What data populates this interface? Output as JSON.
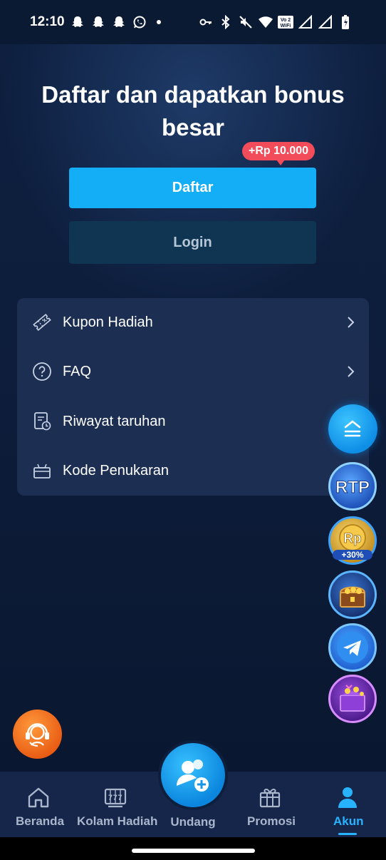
{
  "status_bar": {
    "time": "12:10",
    "left_icons": [
      "snapchat-icon",
      "snapchat-icon",
      "snapchat-icon",
      "whatsapp-icon"
    ],
    "right_icons": [
      "key-icon",
      "bluetooth-icon",
      "mute-icon",
      "wifi-icon",
      "vowifi-icon",
      "signal-icon",
      "signal-icon",
      "battery-icon"
    ],
    "vowifi_text": "Vo WiFi 2"
  },
  "hero": {
    "title": "Daftar dan dapatkan bonus besar",
    "bonus_badge": "+Rp 10.000",
    "register_label": "Daftar",
    "login_label": "Login"
  },
  "menu": {
    "items": [
      {
        "label": "Kupon Hadiah",
        "icon": "coupon-icon",
        "chevron": true
      },
      {
        "label": "FAQ",
        "icon": "question-icon",
        "chevron": true
      },
      {
        "label": "Riwayat taruhan",
        "icon": "history-icon",
        "chevron": false
      },
      {
        "label": "Kode Penukaran",
        "icon": "gift-box-icon",
        "chevron": false
      }
    ]
  },
  "floating": {
    "rtp_text": "RTP",
    "rp_text": "Rp",
    "rp_bonus": "+30%"
  },
  "bottom_nav": {
    "items": [
      {
        "label": "Beranda",
        "icon": "home-icon"
      },
      {
        "label": "Kolam Hadiah",
        "icon": "slot-machine-icon"
      },
      {
        "label": "Undang",
        "icon": "add-user-icon"
      },
      {
        "label": "Promosi",
        "icon": "gift-icon"
      },
      {
        "label": "Akun",
        "icon": "user-icon"
      }
    ],
    "slot_text": "777",
    "active": "Akun"
  },
  "colors": {
    "accent": "#14aef6",
    "badge": "#f24c5b",
    "background": "#0b1a33",
    "card": "#1c2f52"
  }
}
